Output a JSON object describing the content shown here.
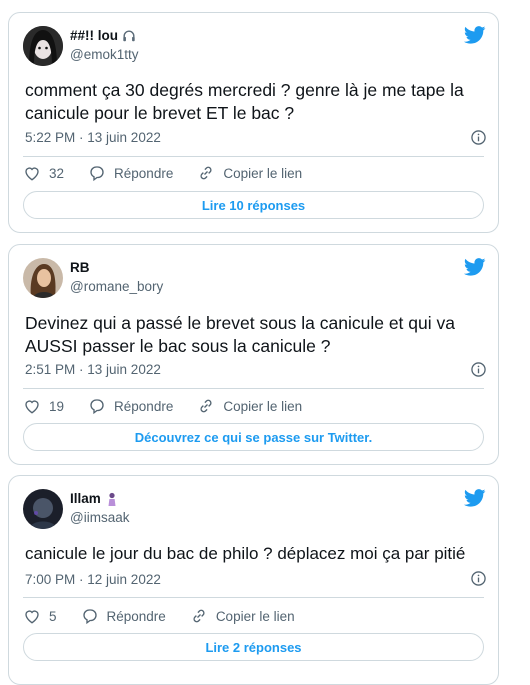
{
  "tweets": [
    {
      "name": "##!! lou",
      "handle": "@emok1tty",
      "text": "comment ça 30 degrés mercredi ? genre là je me tape la canicule pour le brevet ET le bac ?",
      "time": "5:22 PM · 13 juin 2022",
      "likes": "32",
      "reply_label": "Répondre",
      "copy_label": "Copier le lien",
      "cta": "Lire 10 réponses"
    },
    {
      "name": "RB",
      "handle": "@romane_bory",
      "text": "Devinez qui a passé le brevet sous la canicule et qui va AUSSI passer le bac sous la canicule ?",
      "time": "2:51 PM · 13 juin 2022",
      "likes": "19",
      "reply_label": "Répondre",
      "copy_label": "Copier le lien",
      "cta": "Découvrez ce qui se passe sur Twitter."
    },
    {
      "name": "Illam",
      "handle": "@iimsaak",
      "text": "canicule le jour du bac de philo ? déplacez moi ça par pitié",
      "time": "7:00 PM · 12 juin 2022",
      "likes": "5",
      "reply_label": "Répondre",
      "copy_label": "Copier le lien",
      "cta": "Lire 2 réponses"
    }
  ],
  "colors": {
    "accent": "#1d9bf0",
    "muted": "#536471",
    "border": "#cfd9de"
  }
}
